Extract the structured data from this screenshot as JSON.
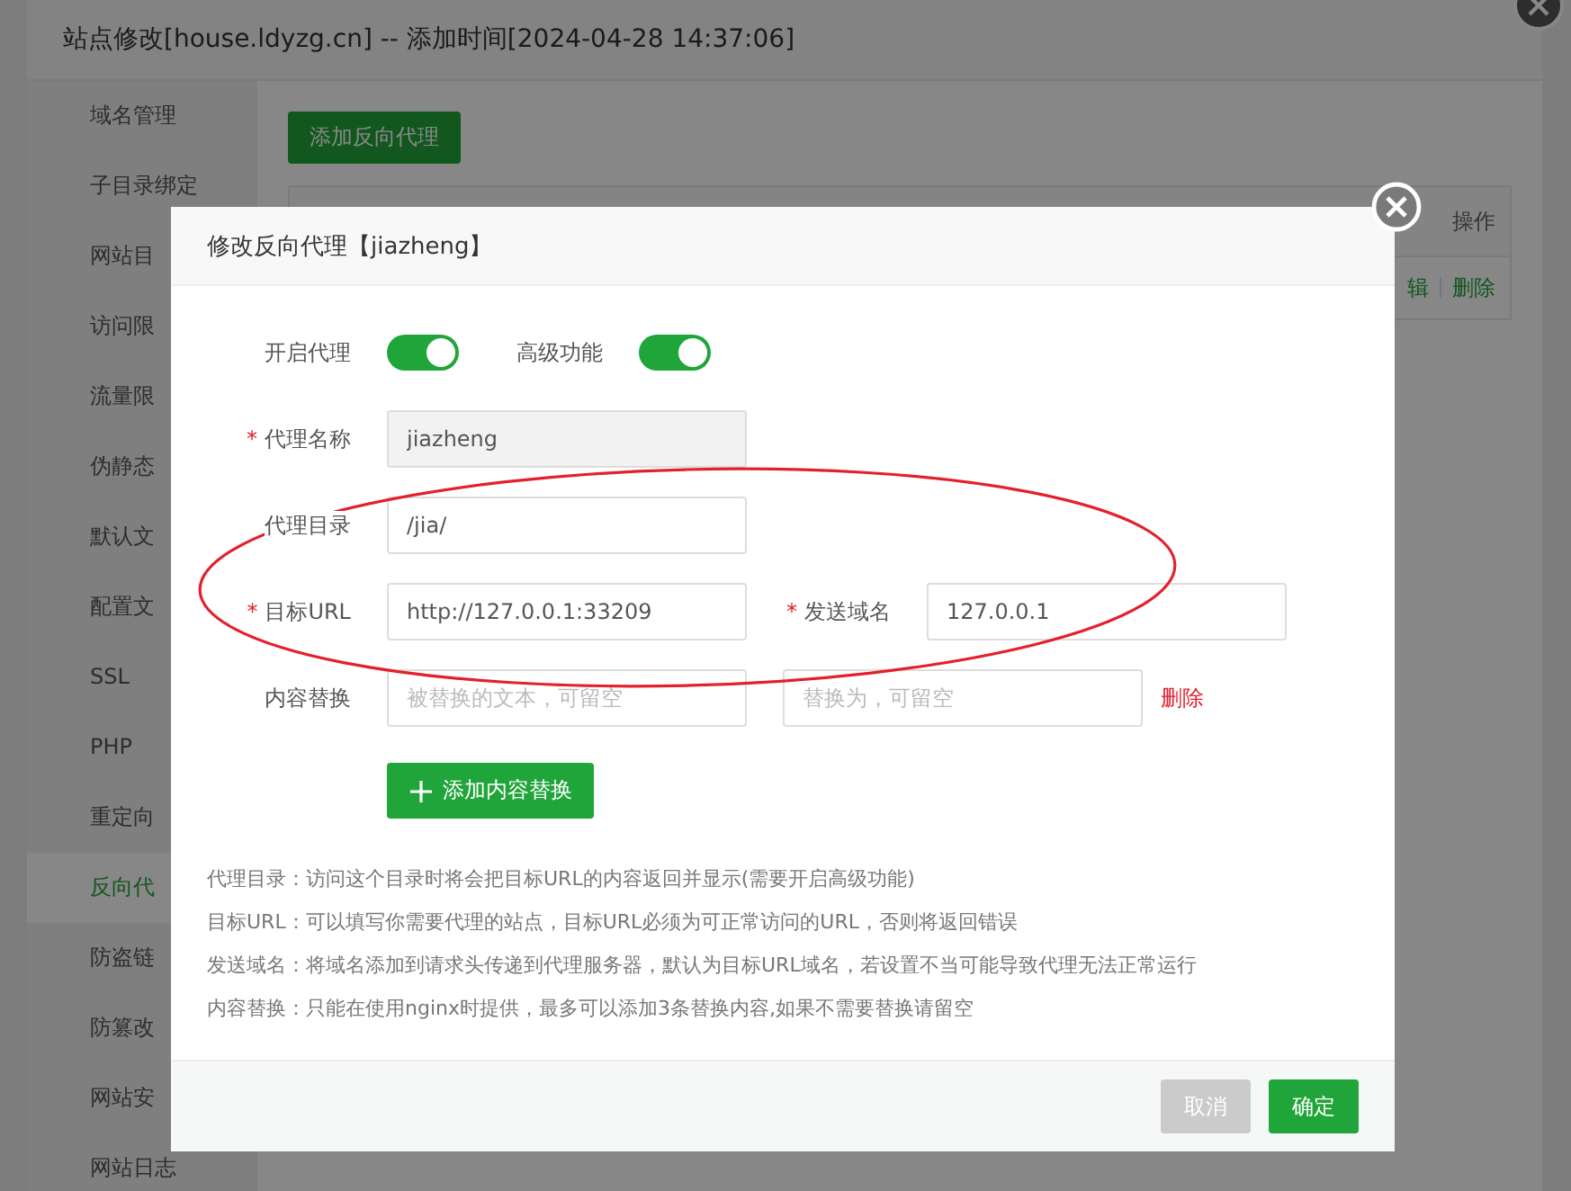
{
  "window": {
    "title": "站点修改[house.ldyzg.cn] -- 添加时间[2024-04-28 14:37:06]"
  },
  "sidebar": {
    "items": [
      {
        "label": "域名管理",
        "selected": false
      },
      {
        "label": "子目录绑定",
        "selected": false
      },
      {
        "label": "网站目",
        "selected": false
      },
      {
        "label": "访问限",
        "selected": false
      },
      {
        "label": "流量限",
        "selected": false
      },
      {
        "label": "伪静态",
        "selected": false
      },
      {
        "label": "默认文",
        "selected": false
      },
      {
        "label": "配置文",
        "selected": false
      },
      {
        "label": "SSL",
        "selected": false
      },
      {
        "label": "PHP",
        "selected": false
      },
      {
        "label": "重定向",
        "selected": false
      },
      {
        "label": "反向代",
        "selected": true
      },
      {
        "label": "防盗链",
        "selected": false
      },
      {
        "label": "防篡改",
        "selected": false
      },
      {
        "label": "网站安",
        "selected": false
      },
      {
        "label": "网站日志",
        "selected": false
      }
    ]
  },
  "toolbar": {
    "add_button": "添加反向代理"
  },
  "table": {
    "columns": [
      "操作"
    ],
    "rows": [
      {
        "actions": [
          "辑",
          "删除"
        ]
      }
    ]
  },
  "dialog": {
    "title": "修改反向代理【jiazheng】",
    "toggles": [
      {
        "label": "开启代理",
        "on": true
      },
      {
        "label": "高级功能",
        "on": true
      }
    ],
    "form_rows": [
      {
        "fields": [
          {
            "label": "代理名称",
            "required_mark": "*",
            "value": "jiazheng",
            "disabled": true
          }
        ]
      },
      {
        "fields": [
          {
            "label": "代理目录",
            "value": "/jia/",
            "disabled": false
          }
        ]
      },
      {
        "fields": [
          {
            "label": "目标URL",
            "required_mark": "*",
            "value": "http://127.0.0.1:33209",
            "disabled": false
          },
          {
            "label": "发送域名",
            "required_mark": "*",
            "value": "127.0.0.1",
            "disabled": false
          }
        ]
      },
      {
        "fields": [
          {
            "label": "内容替换",
            "placeholder": "被替换的文本，可留空",
            "disabled": false
          },
          {
            "placeholder": "替换为，可留空",
            "disabled": false
          }
        ],
        "action": "删除"
      }
    ],
    "add_button": "添加内容替换",
    "notes": [
      "代理目录：访问这个目录时将会把目标URL的内容返回并显示(需要开启高级功能)",
      "目标URL：可以填写你需要代理的站点，目标URL必须为可正常访问的URL，否则将返回错误",
      "发送域名：将域名添加到请求头传递到代理服务器，默认为目标URL域名，若设置不当可能导致代理无法正常运行",
      "内容替换：只能在使用nginx时提供，最多可以添加3条替换内容,如果不需要替换请留空"
    ],
    "buttons": [
      {
        "label": "取消",
        "kind": "cancel"
      },
      {
        "label": "确定",
        "kind": "confirm"
      }
    ]
  }
}
